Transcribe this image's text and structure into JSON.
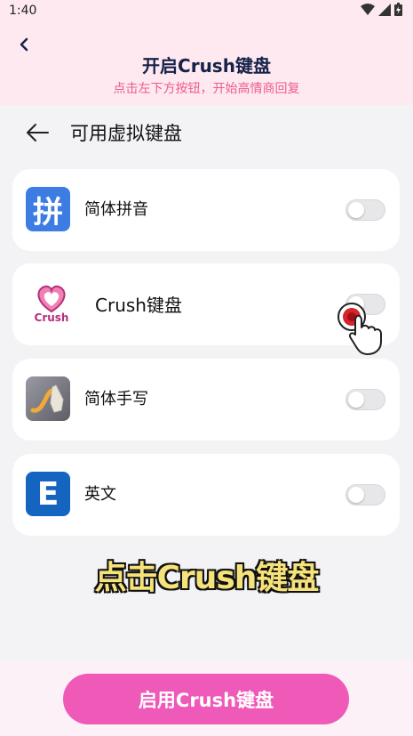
{
  "status_bar": {
    "time": "1:40"
  },
  "header": {
    "title": "开启Crush键盘",
    "subtitle": "点击左下方按钮，开始高情商回复"
  },
  "page": {
    "title": "可用虚拟键盘"
  },
  "keyboards": [
    {
      "label": "简体拼音",
      "icon": "pinyin-icon",
      "icon_text": "拼",
      "enabled": false
    },
    {
      "label": "Crush键盘",
      "icon": "crush-heart-icon",
      "icon_text": "Crush",
      "enabled": false
    },
    {
      "label": "简体手写",
      "icon": "handwriting-icon",
      "enabled": false
    },
    {
      "label": "英文",
      "icon": "english-icon",
      "icon_text": "E",
      "enabled": false
    }
  ],
  "caption": "点击Crush键盘",
  "bottom": {
    "enable_button": "启用Crush键盘"
  },
  "colors": {
    "header_bg": "#fde9ef",
    "subtitle": "#ee5b8e",
    "button": "#ef59b8",
    "caption_fill": "#f6e27a"
  }
}
